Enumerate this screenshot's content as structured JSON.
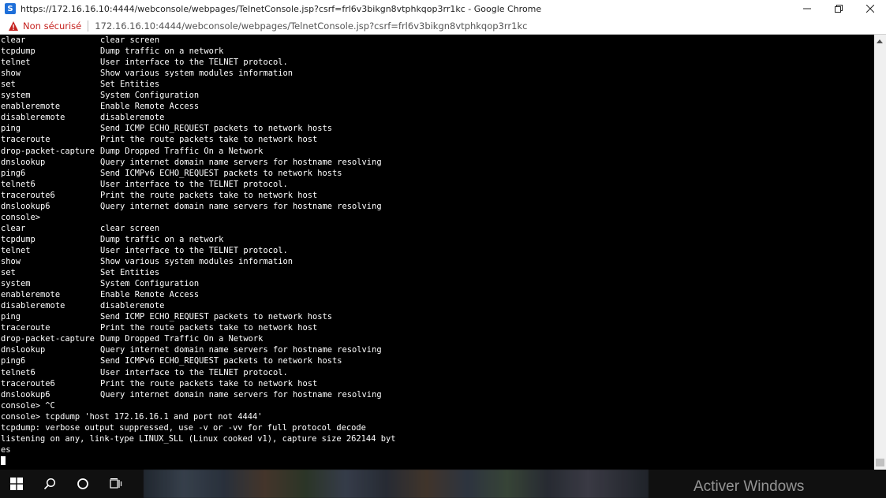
{
  "window": {
    "title": "https://172.16.16.10:4444/webconsole/webpages/TelnetConsole.jsp?csrf=frl6v3bikgn8vtphkqop3rr1kc - Google Chrome",
    "app_icon_letter": "S"
  },
  "address_bar": {
    "security_label": "Non sécurisé",
    "url": "172.16.16.10:4444/webconsole/webpages/TelnetConsole.jsp?csrf=frl6v3bikgn8vtphkqop3rr1kc"
  },
  "console": {
    "help_block_1": [
      {
        "cmd": "clear",
        "desc": "clear screen"
      },
      {
        "cmd": "tcpdump",
        "desc": "Dump traffic on a network"
      },
      {
        "cmd": "telnet",
        "desc": "User interface to the TELNET protocol."
      },
      {
        "cmd": "show",
        "desc": "Show various system modules information"
      },
      {
        "cmd": "set",
        "desc": "Set Entities"
      },
      {
        "cmd": "system",
        "desc": "System Configuration"
      },
      {
        "cmd": "enableremote",
        "desc": "Enable Remote Access"
      },
      {
        "cmd": "disableremote",
        "desc": "disableremote"
      },
      {
        "cmd": "ping",
        "desc": "Send ICMP ECHO_REQUEST packets to network hosts"
      },
      {
        "cmd": "traceroute",
        "desc": "Print the route packets take to network host"
      },
      {
        "cmd": "drop-packet-capture",
        "desc": "Dump Dropped Traffic On a Network"
      },
      {
        "cmd": "dnslookup",
        "desc": "Query internet domain name servers for hostname resolving"
      },
      {
        "cmd": "ping6",
        "desc": "Send ICMPv6 ECHO_REQUEST packets to network hosts"
      },
      {
        "cmd": "telnet6",
        "desc": "User interface to the TELNET protocol."
      },
      {
        "cmd": "traceroute6",
        "desc": "Print the route packets take to network host"
      },
      {
        "cmd": "dnslookup6",
        "desc": "Query internet domain name servers for hostname resolving"
      }
    ],
    "prompt_1": "console>",
    "help_block_2": [
      {
        "cmd": "clear",
        "desc": "clear screen"
      },
      {
        "cmd": "tcpdump",
        "desc": "Dump traffic on a network"
      },
      {
        "cmd": "telnet",
        "desc": "User interface to the TELNET protocol."
      },
      {
        "cmd": "show",
        "desc": "Show various system modules information"
      },
      {
        "cmd": "set",
        "desc": "Set Entities"
      },
      {
        "cmd": "system",
        "desc": "System Configuration"
      },
      {
        "cmd": "enableremote",
        "desc": "Enable Remote Access"
      },
      {
        "cmd": "disableremote",
        "desc": "disableremote"
      },
      {
        "cmd": "ping",
        "desc": "Send ICMP ECHO_REQUEST packets to network hosts"
      },
      {
        "cmd": "traceroute",
        "desc": "Print the route packets take to network host"
      },
      {
        "cmd": "drop-packet-capture",
        "desc": "Dump Dropped Traffic On a Network"
      },
      {
        "cmd": "dnslookup",
        "desc": "Query internet domain name servers for hostname resolving"
      },
      {
        "cmd": "ping6",
        "desc": "Send ICMPv6 ECHO_REQUEST packets to network hosts"
      },
      {
        "cmd": "telnet6",
        "desc": "User interface to the TELNET protocol."
      },
      {
        "cmd": "traceroute6",
        "desc": "Print the route packets take to network host"
      },
      {
        "cmd": "dnslookup6",
        "desc": "Query internet domain name servers for hostname resolving"
      }
    ],
    "tail_lines": [
      "console> ^C",
      "console> tcpdump 'host 172.16.16.1 and port not 4444'",
      "tcpdump: verbose output suppressed, use -v or -vv for full protocol decode",
      "listening on any, link-type LINUX_SLL (Linux cooked v1), capture size 262144 byt",
      "es"
    ]
  },
  "taskbar": {
    "watermark": "Activer Windows"
  }
}
